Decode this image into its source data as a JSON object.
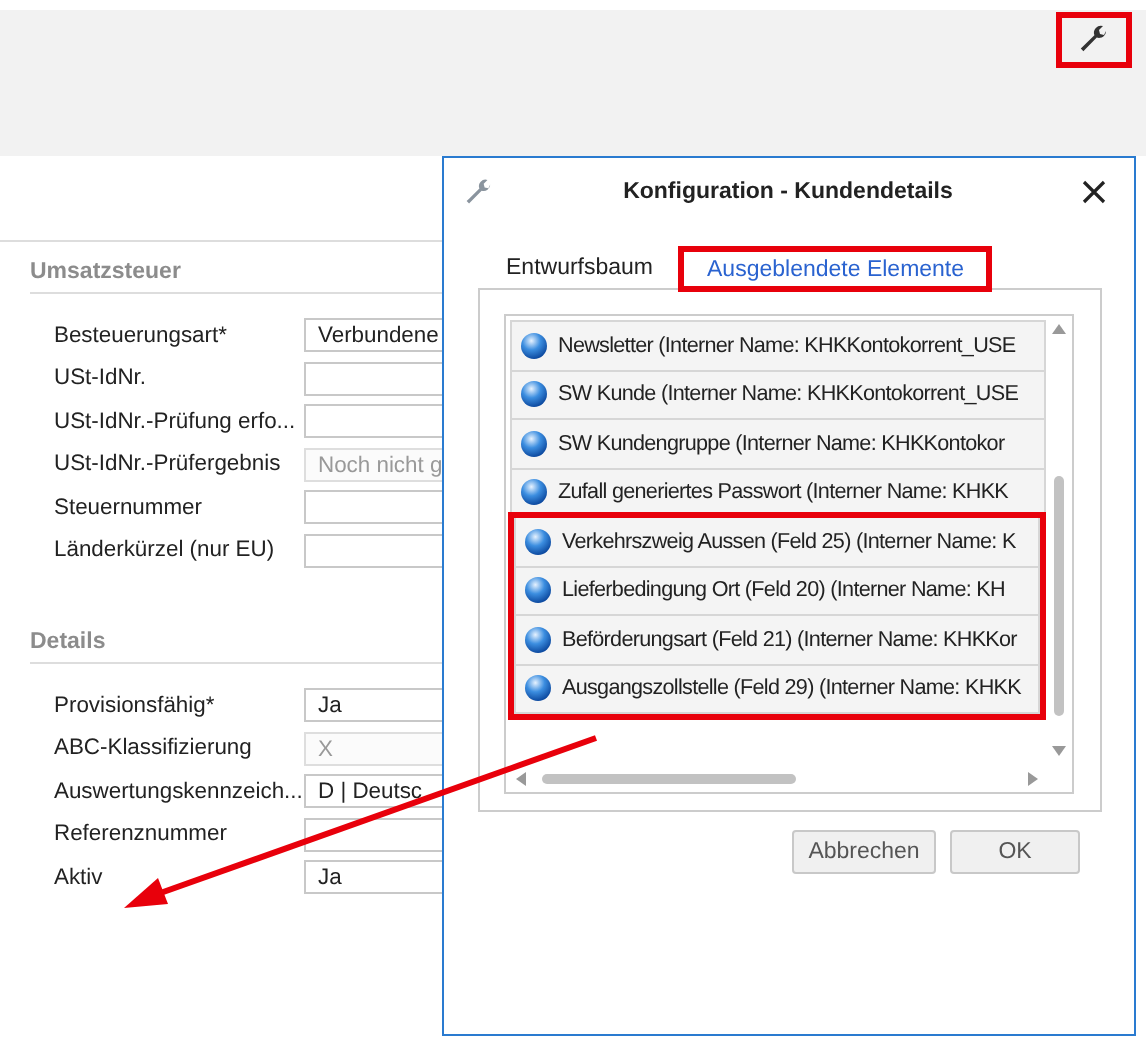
{
  "toolbar": {
    "highlighted": true
  },
  "form": {
    "sections": [
      {
        "title": "Umsatzsteuer",
        "fields": [
          {
            "label": "Besteuerungsart*",
            "value": "Verbundene",
            "disabled": false
          },
          {
            "label": "USt-IdNr.",
            "disabled": false
          },
          {
            "label": "USt-IdNr.-Prüfung erfo...",
            "disabled": false
          },
          {
            "label": "USt-IdNr.-Prüfergebnis",
            "value": "Noch nicht g",
            "disabled": true
          },
          {
            "label": "Steuernummer",
            "disabled": false
          },
          {
            "label": "Länderkürzel (nur EU)",
            "disabled": false
          }
        ]
      },
      {
        "title": "Details",
        "fields": [
          {
            "label": "Provisionsfähig*",
            "value": "Ja",
            "disabled": false
          },
          {
            "label": "ABC-Klassifizierung",
            "value": "X",
            "disabled": true
          },
          {
            "label": "Auswertungskennzeich...",
            "value": "D  |  Deutsc",
            "disabled": false
          },
          {
            "label": "Referenznummer",
            "disabled": false
          },
          {
            "label": "Aktiv",
            "value": "Ja",
            "disabled": false
          }
        ]
      }
    ]
  },
  "dialog": {
    "title": "Konfiguration - Kundendetails",
    "tabs": [
      {
        "label": "Entwurfsbaum",
        "selected": false,
        "highlighted": false
      },
      {
        "label": "Ausgeblendete Elemente",
        "selected": true,
        "highlighted": true
      }
    ],
    "items": [
      {
        "label": "Newsletter (Interner Name: KHKKontokorrent_USE",
        "highlighted": false
      },
      {
        "label": "SW Kunde (Interner Name: KHKKontokorrent_USE",
        "highlighted": false
      },
      {
        "label": "SW Kundengruppe (Interner Name: KHKKontokor",
        "highlighted": false
      },
      {
        "label": "Zufall generiertes Passwort (Interner Name: KHKK",
        "highlighted": false
      },
      {
        "label": "Verkehrszweig Aussen (Feld 25) (Interner Name: K",
        "highlighted": true
      },
      {
        "label": "Lieferbedingung Ort (Feld 20) (Interner Name: KH",
        "highlighted": true
      },
      {
        "label": "Beförderungsart (Feld 21) (Interner Name: KHKKor",
        "highlighted": true
      },
      {
        "label": "Ausgangszollstelle (Feld 29) (Interner Name: KHKK",
        "highlighted": true
      }
    ],
    "buttons": [
      "Abbrechen",
      "OK"
    ]
  }
}
